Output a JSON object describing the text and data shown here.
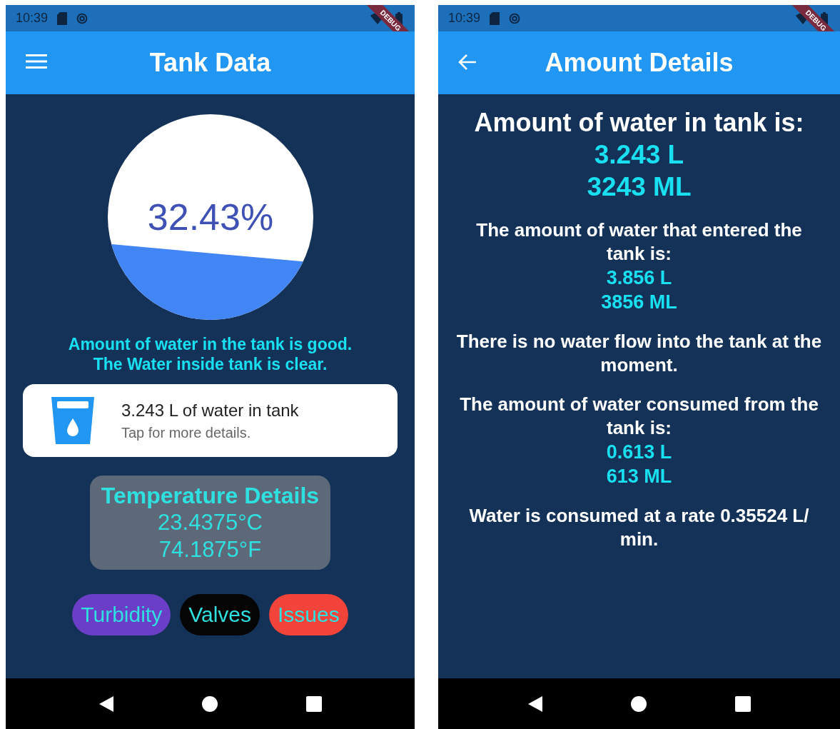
{
  "tank_data_screen": {
    "status_bar": {
      "time": "10:39",
      "debug_banner": "DEBUG"
    },
    "app_bar": {
      "title": "Tank Data"
    },
    "gauge": {
      "label": "32.43%"
    },
    "status_lines": [
      "Amount of water in the tank is good.",
      "The Water inside tank is clear."
    ],
    "tank_card": {
      "title": "3.243 L of water in tank",
      "subtitle": "Tap for more details."
    },
    "temperature": {
      "title": "Temperature Details",
      "celsius": "23.4375°C",
      "fahrenheit": "74.1875°F"
    },
    "buttons": [
      {
        "label": "Turbidity",
        "color": "#6a3ec6"
      },
      {
        "label": "Valves",
        "color": "#050505"
      },
      {
        "label": "Issues",
        "color": "#f2443a"
      }
    ]
  },
  "amount_details_screen": {
    "status_bar": {
      "time": "10:39",
      "debug_banner": "DEBUG"
    },
    "app_bar": {
      "title": "Amount Details"
    },
    "sections": [
      {
        "kind": "headline",
        "text": "Amount of water in tank is:",
        "values": [
          "3.243 L",
          "3243 ML"
        ]
      },
      {
        "kind": "info",
        "text": "The amount of water that entered the tank is:",
        "values": [
          "3.856 L",
          "3856 ML"
        ]
      },
      {
        "kind": "info",
        "text": "There is no water flow into the tank at the moment."
      },
      {
        "kind": "info",
        "text": "The amount of water consumed from the tank is:",
        "values": [
          "0.613 L",
          "613 ML"
        ]
      },
      {
        "kind": "info",
        "text": "Water is consumed at a rate 0.35524 L/ min."
      }
    ]
  }
}
